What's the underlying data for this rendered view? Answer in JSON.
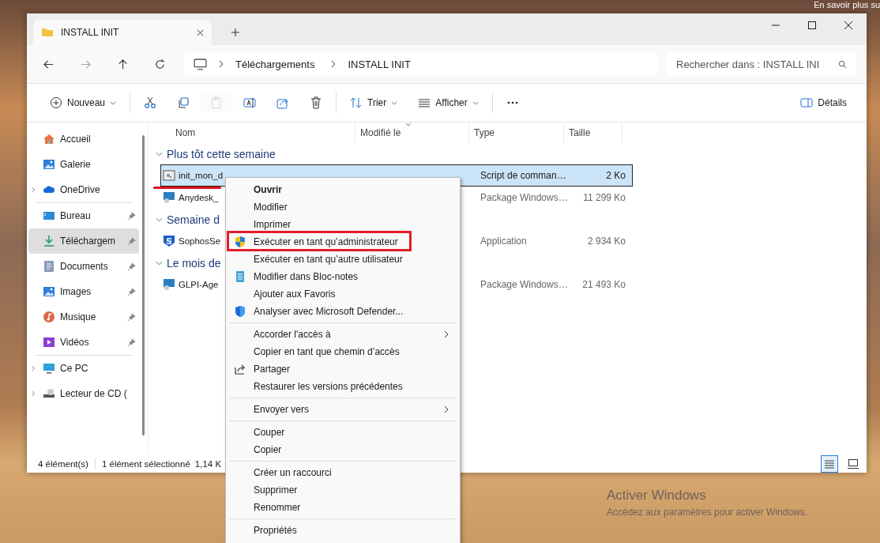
{
  "desktop": {
    "notice": "En savoir plus su",
    "activation_title": "Activer Windows",
    "activation_text": "Accédez aux paramètres pour activer Windows."
  },
  "window": {
    "tab_title": "INSTALL INIT"
  },
  "address": {
    "path": [
      "Téléchargements",
      "INSTALL INIT"
    ]
  },
  "search": {
    "placeholder": "Rechercher dans : INSTALL INI"
  },
  "toolbar": [
    {
      "kind": "new",
      "label": "Nouveau",
      "disabled": false
    },
    {
      "kind": "cut",
      "disabled": false
    },
    {
      "kind": "copy",
      "disabled": false
    },
    {
      "kind": "paste",
      "disabled": true
    },
    {
      "kind": "rename",
      "disabled": false
    },
    {
      "kind": "share",
      "disabled": false
    },
    {
      "kind": "delete",
      "disabled": false
    },
    {
      "kind": "sort",
      "label": "Trier",
      "disabled": false
    },
    {
      "kind": "view",
      "label": "Afficher",
      "disabled": false
    },
    {
      "kind": "more",
      "disabled": false
    },
    {
      "kind": "details",
      "label": "Détails",
      "disabled": false
    }
  ],
  "sidebar": {
    "groups": [
      {
        "items": [
          {
            "label": "Accueil",
            "selected": false,
            "pinned": false,
            "expandable": false
          },
          {
            "label": "Galerie",
            "selected": false,
            "pinned": false,
            "expandable": false
          },
          {
            "label": "OneDrive",
            "selected": false,
            "pinned": false,
            "expandable": true
          }
        ]
      },
      {
        "items": [
          {
            "label": "Bureau",
            "selected": false,
            "pinned": true,
            "expandable": false
          },
          {
            "label": "Téléchargem",
            "selected": true,
            "pinned": true,
            "expandable": false
          },
          {
            "label": "Documents",
            "selected": false,
            "pinned": true,
            "expandable": false
          },
          {
            "label": "Images",
            "selected": false,
            "pinned": true,
            "expandable": false
          },
          {
            "label": "Musique",
            "selected": false,
            "pinned": true,
            "expandable": false
          },
          {
            "label": "Vidéos",
            "selected": false,
            "pinned": true,
            "expandable": false
          }
        ]
      },
      {
        "items": [
          {
            "label": "Ce PC",
            "selected": false,
            "pinned": false,
            "expandable": true
          },
          {
            "label": "Lecteur de CD (",
            "selected": false,
            "pinned": false,
            "expandable": true
          }
        ]
      }
    ]
  },
  "table": {
    "columns": [
      {
        "label": "Nom",
        "sorted": false
      },
      {
        "label": "Modifié le",
        "sorted": true
      },
      {
        "label": "Type",
        "sorted": false
      },
      {
        "label": "Taille",
        "sorted": false
      }
    ],
    "groups": [
      {
        "title": "Plus tôt cette semaine",
        "rows": [
          {
            "name": "init_mon_d",
            "type": "Script de comman…",
            "size": "2 Ko",
            "selected": true,
            "underlined": true
          },
          {
            "name": "Anydesk_",
            "type": "Package Windows…",
            "size": "11 299 Ko",
            "selected": false,
            "underlined": false
          }
        ]
      },
      {
        "title": "Semaine d",
        "rows": [
          {
            "name": "SophosSe",
            "type": "Application",
            "size": "2 934 Ko",
            "selected": false,
            "underlined": false
          }
        ]
      },
      {
        "title": "Le mois de",
        "rows": [
          {
            "name": "GLPI-Age",
            "type": "Package Windows…",
            "size": "21 493 Ko",
            "selected": false,
            "underlined": false
          }
        ]
      }
    ]
  },
  "status_bar": {
    "count": "4 élément(s)",
    "selection": "1 élément sélectionné",
    "size": "1,14 K",
    "view_buttons": [
      {
        "kind": "details",
        "selected": true
      },
      {
        "kind": "tiles",
        "selected": false
      }
    ]
  },
  "context_menu": {
    "items": [
      {
        "kind": "item",
        "label": "Ouvrir",
        "bold": true,
        "submenu": false,
        "highlighted": false
      },
      {
        "kind": "item",
        "label": "Modifier",
        "bold": false,
        "submenu": false,
        "highlighted": false
      },
      {
        "kind": "item",
        "label": "Imprimer",
        "bold": false,
        "submenu": false,
        "highlighted": false
      },
      {
        "kind": "item",
        "label": "Exécuter en tant qu’administrateur",
        "bold": false,
        "submenu": false,
        "highlighted": true
      },
      {
        "kind": "item",
        "label": "Exécuter en tant qu’autre utilisateur",
        "bold": false,
        "submenu": false,
        "highlighted": false
      },
      {
        "kind": "item",
        "label": "Modifier dans Bloc-notes",
        "bold": false,
        "submenu": false,
        "highlighted": false
      },
      {
        "kind": "item",
        "label": "Ajouter aux Favoris",
        "bold": false,
        "submenu": false,
        "highlighted": false
      },
      {
        "kind": "item",
        "label": "Analyser avec Microsoft Defender...",
        "bold": false,
        "submenu": false,
        "highlighted": false
      },
      {
        "kind": "separator"
      },
      {
        "kind": "item",
        "label": "Accorder l'accès à",
        "bold": false,
        "submenu": true,
        "highlighted": false
      },
      {
        "kind": "item",
        "label": "Copier en tant que chemin d’accès",
        "bold": false,
        "submenu": false,
        "highlighted": false
      },
      {
        "kind": "item",
        "label": "Partager",
        "bold": false,
        "submenu": false,
        "highlighted": false
      },
      {
        "kind": "item",
        "label": "Restaurer les versions précédentes",
        "bold": false,
        "submenu": false,
        "highlighted": false
      },
      {
        "kind": "separator"
      },
      {
        "kind": "item",
        "label": "Envoyer vers",
        "bold": false,
        "submenu": true,
        "highlighted": false
      },
      {
        "kind": "separator"
      },
      {
        "kind": "item",
        "label": "Couper",
        "bold": false,
        "submenu": false,
        "highlighted": false
      },
      {
        "kind": "item",
        "label": "Copier",
        "bold": false,
        "submenu": false,
        "highlighted": false
      },
      {
        "kind": "separator"
      },
      {
        "kind": "item",
        "label": "Créer un raccourci",
        "bold": false,
        "submenu": false,
        "highlighted": false
      },
      {
        "kind": "item",
        "label": "Supprimer",
        "bold": false,
        "submenu": false,
        "highlighted": false
      },
      {
        "kind": "item",
        "label": "Renommer",
        "bold": false,
        "submenu": false,
        "highlighted": false
      },
      {
        "kind": "separator"
      },
      {
        "kind": "item",
        "label": "Propriétés",
        "bold": false,
        "submenu": false,
        "highlighted": false
      }
    ]
  }
}
